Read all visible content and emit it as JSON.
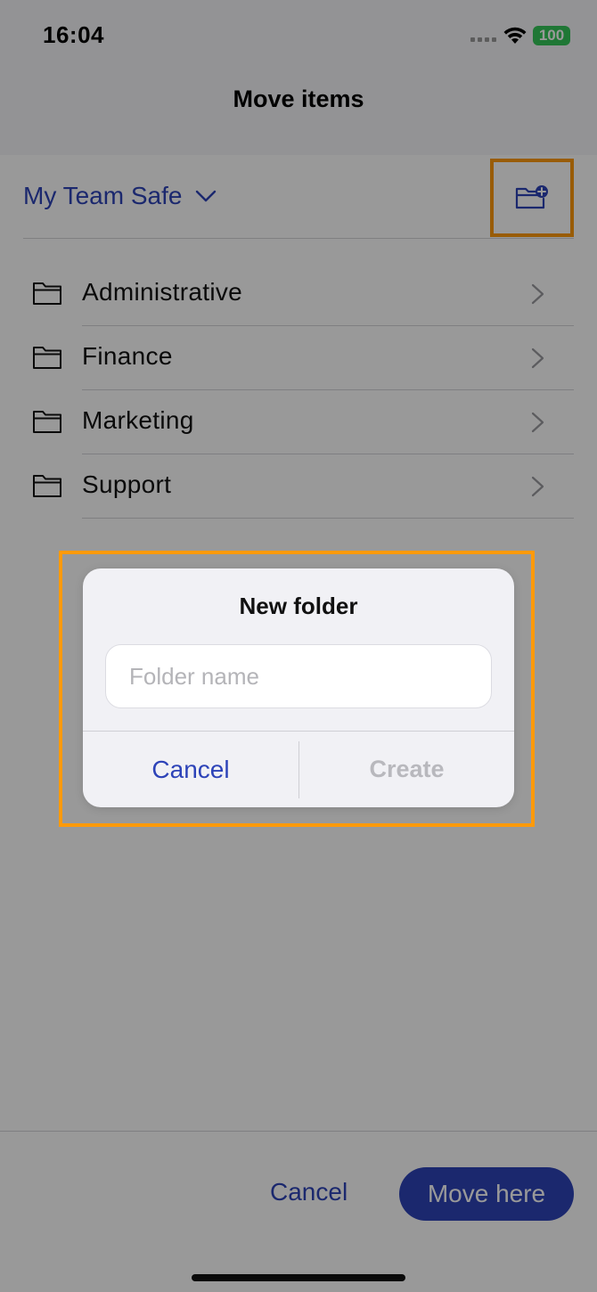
{
  "status_bar": {
    "time": "16:04",
    "battery": "100",
    "battery_color": "#34c759"
  },
  "header": {
    "title": "Move items"
  },
  "safe_selector": {
    "name": "My Team Safe",
    "icon": "chevron-down-icon",
    "new_folder_icon": "folder-plus-icon"
  },
  "folders": [
    {
      "label": "Administrative",
      "icon": "folder-icon"
    },
    {
      "label": "Finance",
      "icon": "folder-icon"
    },
    {
      "label": "Marketing",
      "icon": "folder-icon"
    },
    {
      "label": "Support",
      "icon": "folder-icon"
    }
  ],
  "dialog": {
    "title": "New folder",
    "input_placeholder": "Folder name",
    "input_value": "",
    "cancel_label": "Cancel",
    "create_label": "Create",
    "create_enabled": false
  },
  "footer": {
    "cancel_label": "Cancel",
    "move_here_label": "Move here"
  },
  "colors": {
    "accent": "#2d43b8",
    "highlight": "#ff9a0a",
    "disabled_text": "#b8b8bd"
  }
}
